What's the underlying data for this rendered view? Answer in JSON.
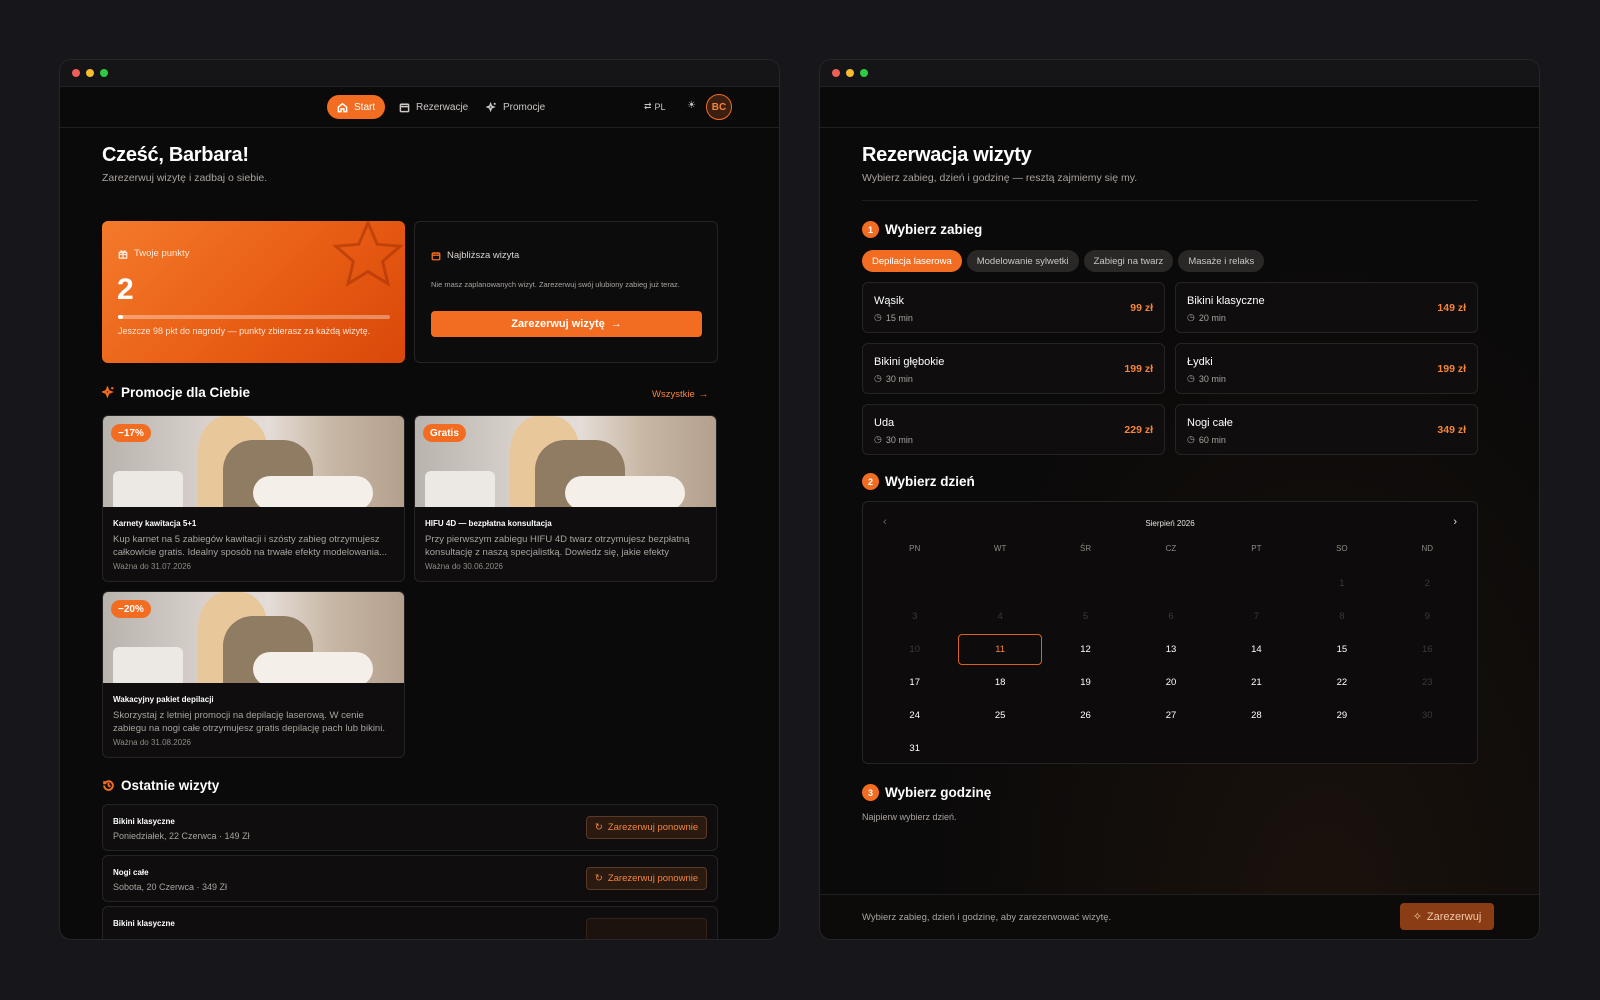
{
  "left": {
    "nav": {
      "start": "Start",
      "reservations": "Rezerwacje",
      "promotions": "Promocje",
      "lang": "PL",
      "avatar": "BC"
    },
    "greeting": "Cześć, Barbara!",
    "greeting_sub": "Zarezerwuj wizytę i zadbaj o siebie.",
    "points": {
      "label": "Twoje punkty",
      "value": "2",
      "progress": 0.02,
      "note": "Jeszcze 98 pkt do nagrody — punkty zbierasz za każdą wizytę."
    },
    "next_visit": {
      "label": "Najbliższa wizyta",
      "text": "Nie masz zaplanowanych wizyt. Zarezerwuj swój ulubiony zabieg już teraz.",
      "button": "Zarezerwuj wizytę"
    },
    "promos_title": "Promocje dla Ciebie",
    "promos_all": "Wszystkie",
    "promos": [
      {
        "badge": "−17%",
        "title": "Karnety kawitacja 5+1",
        "desc": "Kup karnet na 5 zabiegów kawitacji i szósty zabieg otrzymujesz całkowicie gratis. Idealny sposób na trwałe efekty modelowania...",
        "valid": "Ważna do 31.07.2026"
      },
      {
        "badge": "Gratis",
        "title": "HIFU 4D — bezpłatna konsultacja",
        "desc": "Przy pierwszym zabiegu HIFU 4D twarz otrzymujesz bezpłatną konsultację z naszą specjalistką. Dowiedz się, jakie efekty możesz...",
        "valid": "Ważna do 30.06.2026"
      },
      {
        "badge": "−20%",
        "title": "Wakacyjny pakiet depilacji",
        "desc": "Skorzystaj z letniej promocji na depilację laserową. W cenie zabiegu na nogi całe otrzymujesz gratis depilację pach lub bikini. Oferta...",
        "valid": "Ważna do 31.08.2026"
      }
    ],
    "recent_title": "Ostatnie wizyty",
    "recent": [
      {
        "name": "Bikini klasyczne",
        "meta": "Poniedziałek, 22 Czerwca · 149 Zł",
        "button": "Zarezerwuj ponownie"
      },
      {
        "name": "Nogi całe",
        "meta": "Sobota, 20 Czerwca · 349 Zł",
        "button": "Zarezerwuj ponownie"
      },
      {
        "name": "Bikini klasyczne",
        "meta": "",
        "button": ""
      }
    ]
  },
  "right": {
    "title": "Rezerwacja wizyty",
    "subtitle": "Wybierz zabieg, dzień i godzinę — resztą zajmiemy się my.",
    "step1": {
      "num": "1",
      "title": "Wybierz zabieg"
    },
    "categories": [
      "Depilacja laserowa",
      "Modelowanie sylwetki",
      "Zabiegi na twarz",
      "Masaże i relaks"
    ],
    "services": [
      {
        "name": "Wąsik",
        "duration": "15 min",
        "price": "99 zł"
      },
      {
        "name": "Bikini klasyczne",
        "duration": "20 min",
        "price": "149 zł"
      },
      {
        "name": "Bikini głębokie",
        "duration": "30 min",
        "price": "199 zł"
      },
      {
        "name": "Łydki",
        "duration": "30 min",
        "price": "199 zł"
      },
      {
        "name": "Uda",
        "duration": "30 min",
        "price": "229 zł"
      },
      {
        "name": "Nogi całe",
        "duration": "60 min",
        "price": "349 zł"
      }
    ],
    "step2": {
      "num": "2",
      "title": "Wybierz dzień"
    },
    "calendar": {
      "month": "Sierpień 2026",
      "weekdays": [
        "PN",
        "WT",
        "ŚR",
        "CZ",
        "PT",
        "SO",
        "ND"
      ],
      "leading_blanks": 5,
      "days": 31,
      "disabled": [
        1,
        2,
        3,
        4,
        5,
        6,
        7,
        8,
        9,
        10,
        16,
        23,
        30
      ],
      "selected": 11
    },
    "step3": {
      "num": "3",
      "title": "Wybierz godzinę",
      "hint": "Najpierw wybierz dzień."
    },
    "footer": {
      "text": "Wybierz zabieg, dzień i godzinę, aby zarezerwować wizytę.",
      "button": "Zarezerwuj"
    }
  },
  "colors": {
    "accent": "#f26d21",
    "background": "#0b0a0a",
    "page": "#17171b"
  }
}
